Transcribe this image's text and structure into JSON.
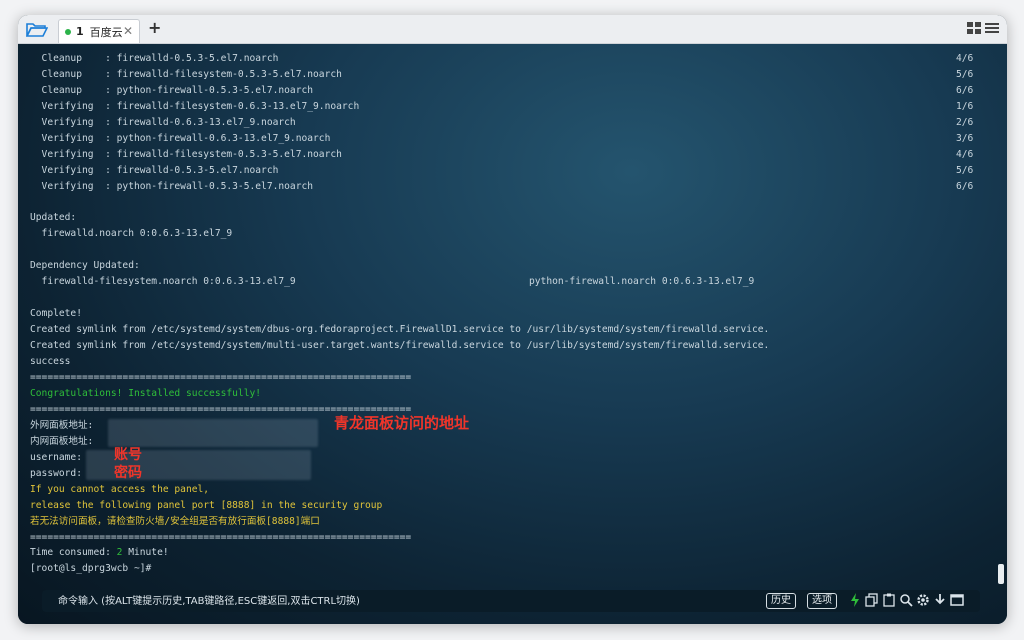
{
  "tab": {
    "number": "1",
    "title": "百度云"
  },
  "terminal": {
    "lines": [
      "  Cleanup    : firewalld-0.5.3-5.el7.noarch",
      "  Cleanup    : firewalld-filesystem-0.5.3-5.el7.noarch",
      "  Cleanup    : python-firewall-0.5.3-5.el7.noarch",
      "  Verifying  : firewalld-filesystem-0.6.3-13.el7_9.noarch",
      "  Verifying  : firewalld-0.6.3-13.el7_9.noarch",
      "  Verifying  : python-firewall-0.6.3-13.el7_9.noarch",
      "  Verifying  : firewalld-filesystem-0.5.3-5.el7.noarch",
      "  Verifying  : firewalld-0.5.3-5.el7.noarch",
      "  Verifying  : python-firewall-0.5.3-5.el7.noarch"
    ],
    "counters": [
      "4/6",
      "5/6",
      "6/6",
      "1/6",
      "2/6",
      "3/6",
      "4/6",
      "5/6",
      "6/6"
    ],
    "updated_label": "Updated:",
    "updated_pkg": "  firewalld.noarch 0:0.6.3-13.el7_9",
    "dep_label": "Dependency Updated:",
    "dep_pkg1": "  firewalld-filesystem.noarch 0:0.6.3-13.el7_9",
    "dep_pkg2": "python-firewall.noarch 0:0.6.3-13.el7_9",
    "complete": "Complete!",
    "symlink1": "Created symlink from /etc/systemd/system/dbus-org.fedoraproject.FirewallD1.service to /usr/lib/systemd/system/firewalld.service.",
    "symlink2": "Created symlink from /etc/systemd/system/multi-user.target.wants/firewalld.service to /usr/lib/systemd/system/firewalld.service.",
    "success": "success",
    "separator": "==================================================================",
    "congrats": "Congratulations! Installed successfully!",
    "outer_addr": "外网面板地址:",
    "inner_addr": "内网面板地址:",
    "username": "username:",
    "password": "password:",
    "warn1": "If you cannot access the panel,",
    "warn2": "release the following panel port [8888] in the security group",
    "warn3": "若无法访问面板，请检查防火墙/安全组是否有放行面板[8888]端口",
    "time_prefix": "Time consumed: ",
    "time_value": "2",
    "time_suffix": " Minute!",
    "prompt": "[root@ls_dprg3wcb ~]#"
  },
  "annotations": {
    "panel_addr": "青龙面板访问的地址",
    "account": "账号",
    "password": "密码"
  },
  "command_bar": {
    "hint": "命令输入 (按ALT键提示历史,TAB键路径,ESC键返回,双击CTRL切换)",
    "history": "历史",
    "options": "选项"
  },
  "colors": {
    "green": "#2fbe3a",
    "yellow": "#e0c43a",
    "annotation_red": "#f0352a"
  }
}
